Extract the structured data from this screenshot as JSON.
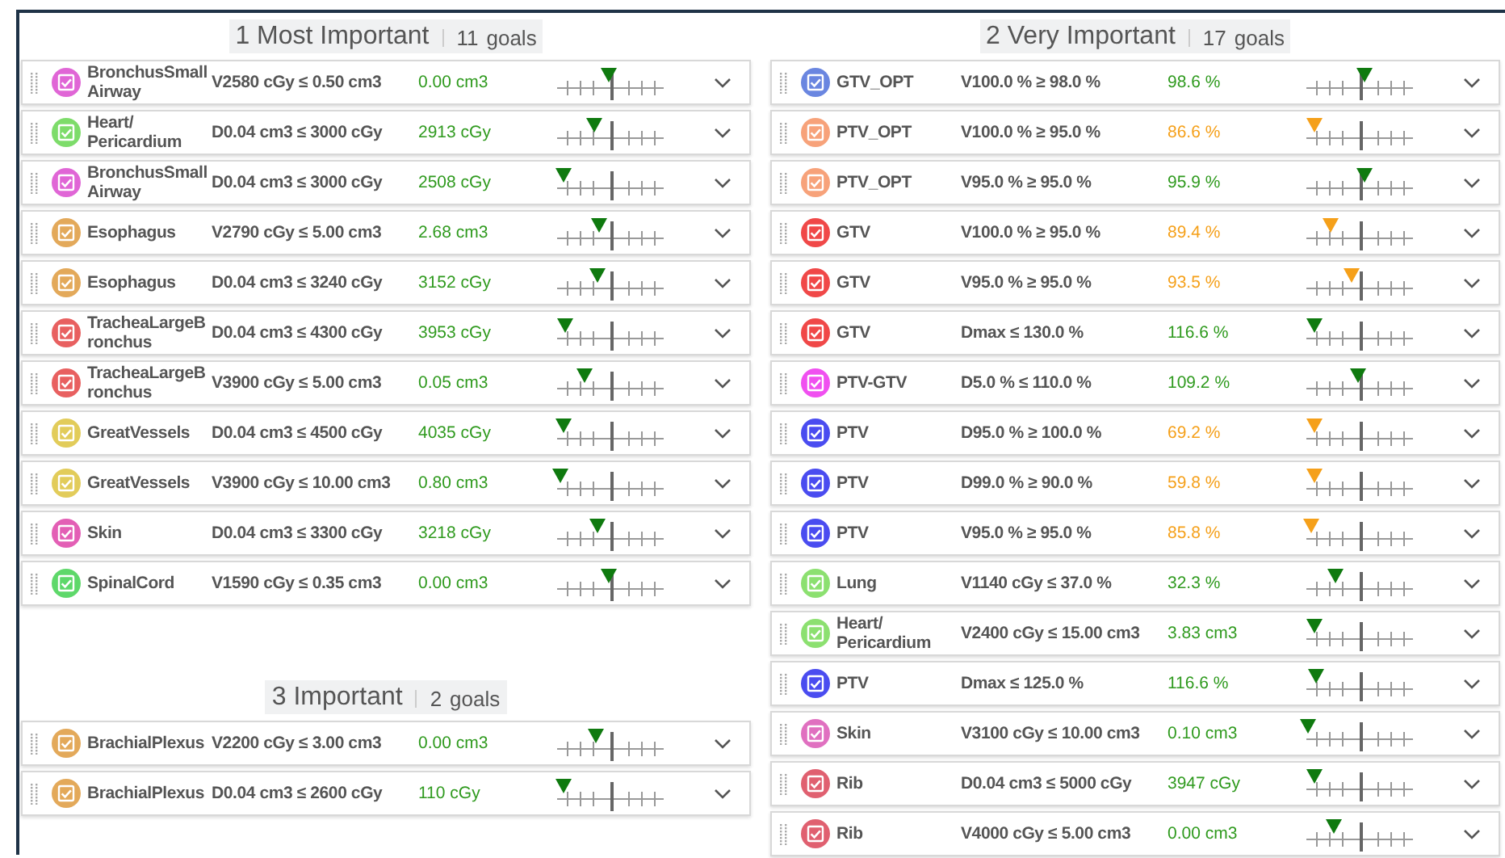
{
  "columns": [
    {
      "sections": [
        {
          "title": "1 Most Important",
          "count": "11",
          "unit": "goals",
          "goals": [
            {
              "checked": true,
              "color": "#e066d6",
              "structure": "BronchusSmall\nAirway",
              "objective": "V2580 cGy ≤ 0.50 cm3",
              "result": "0.00 cm3",
              "met": true,
              "level": 0.48
            },
            {
              "checked": true,
              "color": "#7ddc6a",
              "structure": "Heart/\nPericardium",
              "objective": "D0.04 cm3 ≤ 3000 cGy",
              "result": "2913 cGy",
              "met": true,
              "level": 0.35
            },
            {
              "checked": true,
              "color": "#e066d6",
              "structure": "BronchusSmall\nAirway",
              "objective": "D0.04 cm3 ≤ 3000 cGy",
              "result": "2508 cGy",
              "met": true,
              "level": 0.06
            },
            {
              "checked": true,
              "color": "#e3a95a",
              "structure": "Esophagus",
              "objective": "V2790 cGy ≤ 5.00 cm3",
              "result": "2.68 cm3",
              "met": true,
              "level": 0.39
            },
            {
              "checked": true,
              "color": "#e3a95a",
              "structure": "Esophagus",
              "objective": "D0.04 cm3 ≤ 3240 cGy",
              "result": "3152 cGy",
              "met": true,
              "level": 0.38
            },
            {
              "checked": true,
              "color": "#e86060",
              "structure": "TracheaLargeB\nronchus",
              "objective": "D0.04 cm3 ≤ 4300 cGy",
              "result": "3953 cGy",
              "met": true,
              "level": 0.08
            },
            {
              "checked": true,
              "color": "#e86060",
              "structure": "TracheaLargeB\nronchus",
              "objective": "V3900 cGy ≤ 5.00 cm3",
              "result": "0.05 cm3",
              "met": true,
              "level": 0.26
            },
            {
              "checked": true,
              "color": "#e2cc5a",
              "structure": "GreatVessels",
              "objective": "D0.04 cm3 ≤ 4500 cGy",
              "result": "4035 cGy",
              "met": true,
              "level": 0.06
            },
            {
              "checked": true,
              "color": "#e2cc5a",
              "structure": "GreatVessels",
              "objective": "V3900 cGy ≤ 10.00 cm3",
              "result": "0.80 cm3",
              "met": true,
              "level": 0.03
            },
            {
              "checked": true,
              "color": "#e35fb5",
              "structure": "Skin",
              "objective": "D0.04 cm3 ≤ 3300 cGy",
              "result": "3218 cGy",
              "met": true,
              "level": 0.38
            },
            {
              "checked": true,
              "color": "#5ed86a",
              "structure": "SpinalCord",
              "objective": "V1590 cGy ≤ 0.35 cm3",
              "result": "0.00 cm3",
              "met": true,
              "level": 0.48
            }
          ]
        },
        {
          "title": "3 Important",
          "count": "2",
          "unit": "goals",
          "goals": [
            {
              "checked": true,
              "color": "#e3a95a",
              "structure": "BrachialPlexus",
              "objective": "V2200 cGy ≤ 3.00 cm3",
              "result": "0.00 cm3",
              "met": true,
              "level": 0.36
            },
            {
              "checked": true,
              "color": "#e3a95a",
              "structure": "BrachialPlexus",
              "objective": "D0.04 cm3 ≤ 2600 cGy",
              "result": "110 cGy",
              "met": true,
              "level": 0.06
            }
          ]
        }
      ]
    },
    {
      "sections": [
        {
          "title": "2 Very Important",
          "count": "17",
          "unit": "goals",
          "goals": [
            {
              "checked": true,
              "color": "#6a86e0",
              "structure": "GTV_OPT",
              "objective": "V100.0 % ≥ 98.0 %",
              "result": "98.6 %",
              "met": true,
              "level": 0.55
            },
            {
              "checked": true,
              "color": "#f7a27a",
              "structure": "PTV_OPT",
              "objective": "V100.0 % ≥ 95.0 %",
              "result": "86.6 %",
              "met": false,
              "level": 0.07
            },
            {
              "checked": true,
              "color": "#f7a27a",
              "structure": "PTV_OPT",
              "objective": "V95.0 % ≥ 95.0 %",
              "result": "95.9 %",
              "met": true,
              "level": 0.55
            },
            {
              "checked": true,
              "color": "#f04848",
              "structure": "GTV",
              "objective": "V100.0 % ≥ 95.0 %",
              "result": "89.4 %",
              "met": false,
              "level": 0.22
            },
            {
              "checked": true,
              "color": "#f04848",
              "structure": "GTV",
              "objective": "V95.0 % ≥ 95.0 %",
              "result": "93.5 %",
              "met": false,
              "level": 0.43
            },
            {
              "checked": true,
              "color": "#f04848",
              "structure": "GTV",
              "objective": "Dmax ≤ 130.0 %",
              "result": "116.6 %",
              "met": true,
              "level": 0.07
            },
            {
              "checked": true,
              "color": "#f050f0",
              "structure": "PTV-GTV",
              "objective": "D5.0 % ≤ 110.0 %",
              "result": "109.2 %",
              "met": true,
              "level": 0.48
            },
            {
              "checked": true,
              "color": "#4a4cf0",
              "structure": "PTV",
              "objective": "D95.0 % ≥ 100.0 %",
              "result": "69.2 %",
              "met": false,
              "level": 0.07
            },
            {
              "checked": true,
              "color": "#4a4cf0",
              "structure": "PTV",
              "objective": "D99.0 % ≥ 90.0 %",
              "result": "59.8 %",
              "met": false,
              "level": 0.07
            },
            {
              "checked": true,
              "color": "#4a4cf0",
              "structure": "PTV",
              "objective": "V95.0 % ≥ 95.0 %",
              "result": "85.8 %",
              "met": false,
              "level": 0.04
            },
            {
              "checked": true,
              "color": "#8ce070",
              "structure": "Lung",
              "objective": "V1140 cGy ≤ 37.0 %",
              "result": "32.3 %",
              "met": true,
              "level": 0.28
            },
            {
              "checked": true,
              "color": "#8ce070",
              "structure": "Heart/\nPericardium",
              "objective": "V2400 cGy ≤ 15.00 cm3",
              "result": "3.83 cm3",
              "met": true,
              "level": 0.07
            },
            {
              "checked": true,
              "color": "#4a4cf0",
              "structure": "PTV",
              "objective": "Dmax ≤ 125.0 %",
              "result": "116.6 %",
              "met": true,
              "level": 0.09
            },
            {
              "checked": true,
              "color": "#e070c0",
              "structure": "Skin",
              "objective": "V3100 cGy ≤ 10.00 cm3",
              "result": "0.10 cm3",
              "met": true,
              "level": 0.01
            },
            {
              "checked": true,
              "color": "#e06070",
              "structure": "Rib",
              "objective": "D0.04 cm3 ≤ 5000 cGy",
              "result": "3947 cGy",
              "met": true,
              "level": 0.07
            },
            {
              "checked": true,
              "color": "#e06070",
              "structure": "Rib",
              "objective": "V4000 cGy ≤ 5.00 cm3",
              "result": "0.00 cm3",
              "met": true,
              "level": 0.26
            }
          ]
        }
      ]
    }
  ]
}
